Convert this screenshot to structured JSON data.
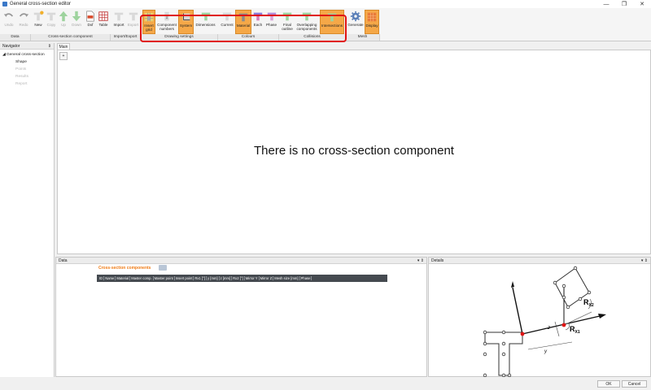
{
  "window": {
    "title": "General cross-section editor",
    "minimize": "—",
    "maximize": "❐",
    "close": "✕"
  },
  "ribbon": {
    "data": {
      "label": "Data",
      "undo": "Undo",
      "redo": "Redo"
    },
    "component": {
      "label": "Cross-section component",
      "new": "New",
      "copy": "Copy",
      "up": "Up",
      "down": "Down",
      "dxf": "Dxf",
      "table": "Table"
    },
    "io": {
      "label": "Import/Export",
      "import": "Import",
      "export": "Export"
    },
    "drawing": {
      "label": "Drawing settings",
      "insert_grid": "Insert grid",
      "component_numbers": "Component numbers",
      "system": "System",
      "dimensions": "Dimensions"
    },
    "colours": {
      "label": "Colours",
      "current": "Current",
      "material": "Material",
      "each": "Each",
      "phase": "Phase"
    },
    "collisions": {
      "label": "Collisions",
      "final_outline": "Final outline",
      "overlapping": "Overlapping components",
      "intersections": "Intersections"
    },
    "mesh": {
      "label": "Mesh",
      "generate": "Generate",
      "display": "Display"
    }
  },
  "navigator": {
    "title": "Navigator",
    "pin": "⇕",
    "root": "General cross-section",
    "items": [
      "Shape",
      "Points",
      "Results",
      "Report"
    ]
  },
  "main": {
    "tab": "Main",
    "message": "There is no cross-section component",
    "zoom_btn": "+"
  },
  "data_pane": {
    "title": "Data",
    "section_title": "Cross-section components",
    "columns": [
      "ID",
      "Name",
      "Material",
      "Master comp.",
      "Master point",
      "Insert point",
      "Rx1 [°]",
      "y [mm]",
      "z [mm]",
      "Rx2 [°]",
      "Mirror Y",
      "Mirror Z",
      "Mesh size [mm]",
      "Phase"
    ],
    "pin": "▾ ⇕"
  },
  "details_pane": {
    "title": "Details",
    "pin": "▾ ⇕",
    "labels": {
      "rx2_main": "R",
      "rx2_sub": "X2",
      "rx1_main": "R",
      "rx1_sub": "X1",
      "z": "z",
      "y": "y"
    }
  },
  "footer": {
    "ok": "OK",
    "cancel": "Cancel"
  },
  "colors": {
    "active_button": "#f5a848",
    "highlight_box": "#e01414",
    "section_title": "#f07c16",
    "grid_header": "#454a50"
  }
}
